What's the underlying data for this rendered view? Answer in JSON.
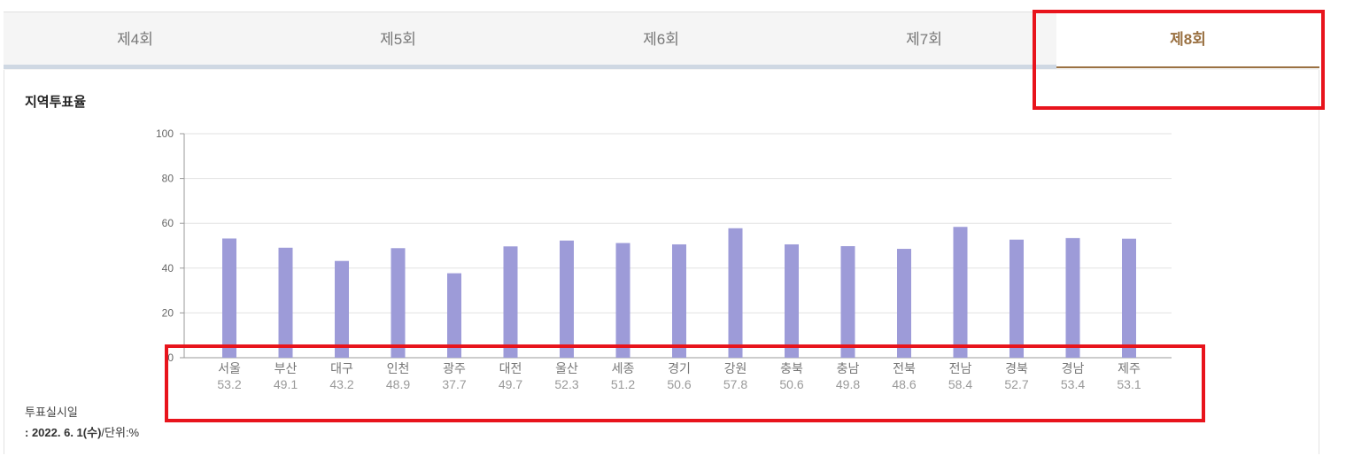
{
  "tabs": [
    {
      "label": "제4회",
      "active": false
    },
    {
      "label": "제5회",
      "active": false
    },
    {
      "label": "제6회",
      "active": false
    },
    {
      "label": "제7회",
      "active": false
    },
    {
      "label": "제8회",
      "active": true
    }
  ],
  "section_title": "지역투표율",
  "footnote": {
    "label": "투표실시일",
    "date_prefix": ": ",
    "date": "2022. 6. 1(수)",
    "unit": "/단위:%"
  },
  "colors": {
    "bar": "#9d9bd8",
    "active_tab": "#9a7142",
    "highlight": "#e8141c"
  },
  "chart_data": {
    "type": "bar",
    "title": "",
    "xlabel": "",
    "ylabel": "",
    "ylim": [
      0,
      100
    ],
    "yticks": [
      0,
      20,
      40,
      60,
      80,
      100
    ],
    "grid": true,
    "categories": [
      "서울",
      "부산",
      "대구",
      "인천",
      "광주",
      "대전",
      "울산",
      "세종",
      "경기",
      "강원",
      "충북",
      "충남",
      "전북",
      "전남",
      "경북",
      "경남",
      "제주"
    ],
    "values": [
      53.2,
      49.1,
      43.2,
      48.9,
      37.7,
      49.7,
      52.3,
      51.2,
      50.6,
      57.8,
      50.6,
      49.8,
      48.6,
      58.4,
      52.7,
      53.4,
      53.1
    ],
    "value_labels": [
      "53.2",
      "49.1",
      "43.2",
      "48.9",
      "37.7",
      "49.7",
      "52.3",
      "51.2",
      "50.6",
      "57.8",
      "50.6",
      "49.8",
      "48.6",
      "58.4",
      "52.7",
      "53.4",
      "53.1"
    ]
  }
}
